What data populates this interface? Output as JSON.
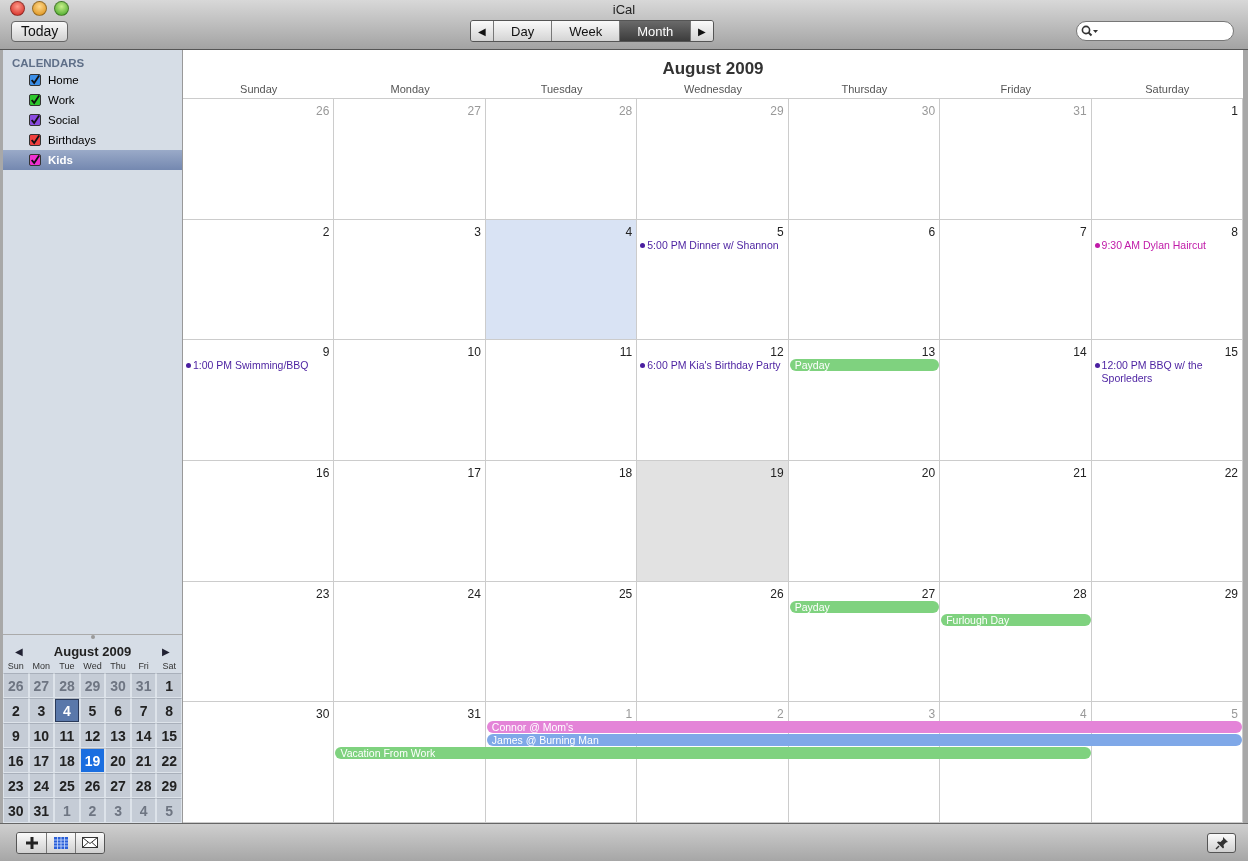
{
  "window": {
    "title": "iCal"
  },
  "toolbar": {
    "today_button": "Today",
    "prev": "◀",
    "next": "▶",
    "views": [
      {
        "label": "Day",
        "selected": false
      },
      {
        "label": "Week",
        "selected": false
      },
      {
        "label": "Month",
        "selected": true
      }
    ]
  },
  "bottom_bar": {
    "mini_calendar_on": true
  },
  "sidebar": {
    "heading": "CALENDARS",
    "items": [
      {
        "name": "Home",
        "color": "#3a8ee8",
        "checked": true,
        "selected": false
      },
      {
        "name": "Work",
        "color": "#2ec82e",
        "checked": true,
        "selected": false
      },
      {
        "name": "Social",
        "color": "#8a4ae0",
        "checked": true,
        "selected": false
      },
      {
        "name": "Birthdays",
        "color": "#f04040",
        "checked": true,
        "selected": false
      },
      {
        "name": "Kids",
        "color": "#f030d0",
        "checked": true,
        "selected": true
      }
    ]
  },
  "mini_calendar": {
    "title": "August 2009",
    "prev": "◀",
    "next": "▶",
    "day_names": [
      "Sun",
      "Mon",
      "Tue",
      "Wed",
      "Thu",
      "Fri",
      "Sat"
    ],
    "weeks": [
      [
        {
          "d": "26",
          "current": false,
          "selected": false,
          "today": false
        },
        {
          "d": "27",
          "current": false,
          "selected": false,
          "today": false
        },
        {
          "d": "28",
          "current": false,
          "selected": false,
          "today": false
        },
        {
          "d": "29",
          "current": false,
          "selected": false,
          "today": false
        },
        {
          "d": "30",
          "current": false,
          "selected": false,
          "today": false
        },
        {
          "d": "31",
          "current": false,
          "selected": false,
          "today": false
        },
        {
          "d": "1",
          "current": true,
          "selected": false,
          "today": false
        }
      ],
      [
        {
          "d": "2",
          "current": true,
          "selected": false,
          "today": false
        },
        {
          "d": "3",
          "current": true,
          "selected": false,
          "today": false
        },
        {
          "d": "4",
          "current": true,
          "selected": true,
          "today": false
        },
        {
          "d": "5",
          "current": true,
          "selected": false,
          "today": false
        },
        {
          "d": "6",
          "current": true,
          "selected": false,
          "today": false
        },
        {
          "d": "7",
          "current": true,
          "selected": false,
          "today": false
        },
        {
          "d": "8",
          "current": true,
          "selected": false,
          "today": false
        }
      ],
      [
        {
          "d": "9",
          "current": true,
          "selected": false,
          "today": false
        },
        {
          "d": "10",
          "current": true,
          "selected": false,
          "today": false
        },
        {
          "d": "11",
          "current": true,
          "selected": false,
          "today": false
        },
        {
          "d": "12",
          "current": true,
          "selected": false,
          "today": false
        },
        {
          "d": "13",
          "current": true,
          "selected": false,
          "today": false
        },
        {
          "d": "14",
          "current": true,
          "selected": false,
          "today": false
        },
        {
          "d": "15",
          "current": true,
          "selected": false,
          "today": false
        }
      ],
      [
        {
          "d": "16",
          "current": true,
          "selected": false,
          "today": false
        },
        {
          "d": "17",
          "current": true,
          "selected": false,
          "today": false
        },
        {
          "d": "18",
          "current": true,
          "selected": false,
          "today": false
        },
        {
          "d": "19",
          "current": true,
          "selected": false,
          "today": true
        },
        {
          "d": "20",
          "current": true,
          "selected": false,
          "today": false
        },
        {
          "d": "21",
          "current": true,
          "selected": false,
          "today": false
        },
        {
          "d": "22",
          "current": true,
          "selected": false,
          "today": false
        }
      ],
      [
        {
          "d": "23",
          "current": true,
          "selected": false,
          "today": false
        },
        {
          "d": "24",
          "current": true,
          "selected": false,
          "today": false
        },
        {
          "d": "25",
          "current": true,
          "selected": false,
          "today": false
        },
        {
          "d": "26",
          "current": true,
          "selected": false,
          "today": false
        },
        {
          "d": "27",
          "current": true,
          "selected": false,
          "today": false
        },
        {
          "d": "28",
          "current": true,
          "selected": false,
          "today": false
        },
        {
          "d": "29",
          "current": true,
          "selected": false,
          "today": false
        }
      ],
      [
        {
          "d": "30",
          "current": true,
          "selected": false,
          "today": false
        },
        {
          "d": "31",
          "current": true,
          "selected": false,
          "today": false
        },
        {
          "d": "1",
          "current": false,
          "selected": false,
          "today": false
        },
        {
          "d": "2",
          "current": false,
          "selected": false,
          "today": false
        },
        {
          "d": "3",
          "current": false,
          "selected": false,
          "today": false
        },
        {
          "d": "4",
          "current": false,
          "selected": false,
          "today": false
        },
        {
          "d": "5",
          "current": false,
          "selected": false,
          "today": false
        }
      ]
    ]
  },
  "month_view": {
    "title": "August 2009",
    "day_names": [
      "Sunday",
      "Monday",
      "Tuesday",
      "Wednesday",
      "Thursday",
      "Friday",
      "Saturday"
    ],
    "weeks": [
      {
        "days": [
          {
            "date": "26",
            "current": false,
            "selected": false,
            "today": false
          },
          {
            "date": "27",
            "current": false,
            "selected": false,
            "today": false
          },
          {
            "date": "28",
            "current": false,
            "selected": false,
            "today": false
          },
          {
            "date": "29",
            "current": false,
            "selected": false,
            "today": false
          },
          {
            "date": "30",
            "current": false,
            "selected": false,
            "today": false
          },
          {
            "date": "31",
            "current": false,
            "selected": false,
            "today": false
          },
          {
            "date": "1",
            "current": true,
            "selected": false,
            "today": false
          }
        ]
      },
      {
        "days": [
          {
            "date": "2",
            "current": true,
            "selected": false,
            "today": false
          },
          {
            "date": "3",
            "current": true,
            "selected": false,
            "today": false
          },
          {
            "date": "4",
            "current": true,
            "selected": true,
            "today": false
          },
          {
            "date": "5",
            "current": true,
            "selected": false,
            "today": false,
            "events": [
              {
                "title": "5:00 PM Dinner w/ Shannon",
                "color": "#4a1fa0"
              }
            ]
          },
          {
            "date": "6",
            "current": true,
            "selected": false,
            "today": false
          },
          {
            "date": "7",
            "current": true,
            "selected": false,
            "today": false
          },
          {
            "date": "8",
            "current": true,
            "selected": false,
            "today": false,
            "events": [
              {
                "title": "9:30 AM Dylan Haircut",
                "color": "#c01aa8"
              }
            ]
          }
        ]
      },
      {
        "days": [
          {
            "date": "9",
            "current": true,
            "selected": false,
            "today": false,
            "events": [
              {
                "title": "1:00 PM Swimming/BBQ",
                "color": "#4a1fa0"
              }
            ]
          },
          {
            "date": "10",
            "current": true,
            "selected": false,
            "today": false
          },
          {
            "date": "11",
            "current": true,
            "selected": false,
            "today": false
          },
          {
            "date": "12",
            "current": true,
            "selected": false,
            "today": false,
            "events": [
              {
                "title": "6:00 PM Kia's Birthday Party",
                "color": "#4a1fa0"
              }
            ]
          },
          {
            "date": "13",
            "current": true,
            "selected": false,
            "today": false
          },
          {
            "date": "14",
            "current": true,
            "selected": false,
            "today": false
          },
          {
            "date": "15",
            "current": true,
            "selected": false,
            "today": false,
            "events": [
              {
                "title": "12:00 PM BBQ w/ the Sporleders",
                "color": "#4a1fa0"
              }
            ]
          }
        ],
        "bars": [
          {
            "title": "Payday",
            "color": "#7fd27f",
            "covers": [
              false,
              false,
              false,
              false,
              true,
              false,
              false
            ]
          }
        ]
      },
      {
        "days": [
          {
            "date": "16",
            "current": true,
            "selected": false,
            "today": false
          },
          {
            "date": "17",
            "current": true,
            "selected": false,
            "today": false
          },
          {
            "date": "18",
            "current": true,
            "selected": false,
            "today": false
          },
          {
            "date": "19",
            "current": true,
            "selected": false,
            "today": true
          },
          {
            "date": "20",
            "current": true,
            "selected": false,
            "today": false
          },
          {
            "date": "21",
            "current": true,
            "selected": false,
            "today": false
          },
          {
            "date": "22",
            "current": true,
            "selected": false,
            "today": false
          }
        ]
      },
      {
        "days": [
          {
            "date": "23",
            "current": true,
            "selected": false,
            "today": false
          },
          {
            "date": "24",
            "current": true,
            "selected": false,
            "today": false
          },
          {
            "date": "25",
            "current": true,
            "selected": false,
            "today": false
          },
          {
            "date": "26",
            "current": true,
            "selected": false,
            "today": false
          },
          {
            "date": "27",
            "current": true,
            "selected": false,
            "today": false
          },
          {
            "date": "28",
            "current": true,
            "selected": false,
            "today": false
          },
          {
            "date": "29",
            "current": true,
            "selected": false,
            "today": false
          }
        ],
        "bars": [
          {
            "title": "Payday",
            "color": "#7fd27f",
            "covers": [
              false,
              false,
              false,
              false,
              true,
              false,
              false
            ]
          },
          {
            "title": "Furlough Day",
            "color": "#7fd27f",
            "covers": [
              false,
              false,
              false,
              false,
              false,
              true,
              false
            ]
          }
        ]
      },
      {
        "days": [
          {
            "date": "30",
            "current": true,
            "selected": false,
            "today": false
          },
          {
            "date": "31",
            "current": true,
            "selected": false,
            "today": false
          },
          {
            "date": "1",
            "current": false,
            "selected": false,
            "today": false
          },
          {
            "date": "2",
            "current": false,
            "selected": false,
            "today": false
          },
          {
            "date": "3",
            "current": false,
            "selected": false,
            "today": false
          },
          {
            "date": "4",
            "current": false,
            "selected": false,
            "today": false
          },
          {
            "date": "5",
            "current": false,
            "selected": false,
            "today": false
          }
        ],
        "bars": [
          {
            "title": "Connor @ Mom's",
            "color": "#e484d8",
            "covers": [
              false,
              false,
              true,
              true,
              true,
              true,
              true
            ]
          },
          {
            "title": "James @ Burning Man",
            "color": "#7fa8e8",
            "covers": [
              false,
              false,
              true,
              true,
              true,
              true,
              true
            ]
          },
          {
            "title": "Vacation From Work",
            "color": "#7fd27f",
            "covers": [
              false,
              true,
              true,
              true,
              true,
              true,
              false
            ]
          }
        ]
      }
    ]
  }
}
